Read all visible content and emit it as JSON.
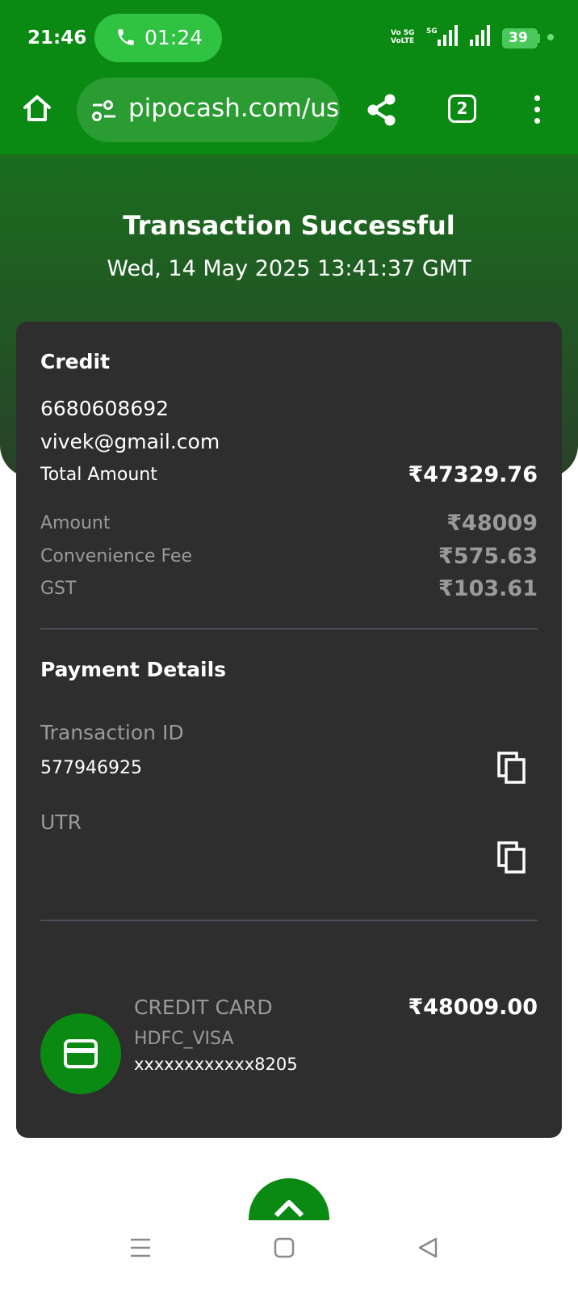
{
  "status_bar": {
    "time": "21:46",
    "call_timer": "01:24",
    "network_label_1": "Vo 5G",
    "network_label_2": "VoLTE",
    "network_type": "5G",
    "battery": "39"
  },
  "browser": {
    "url": "pipocash.com/us",
    "tab_count": "2"
  },
  "header": {
    "title": "Transaction Successful",
    "datetime": "Wed, 14 May 2025 13:41:37 GMT"
  },
  "summary": {
    "type_label": "Credit",
    "phone": "6680608692",
    "email": "vivek@gmail.com",
    "total_label": "Total Amount",
    "total_value": "₹47329.76",
    "rows": [
      {
        "label": "Amount",
        "value": "₹48009"
      },
      {
        "label": "Convenience Fee",
        "value": "₹575.63"
      },
      {
        "label": "GST",
        "value": "₹103.61"
      }
    ]
  },
  "payment_details": {
    "heading": "Payment Details",
    "transaction_id_label": "Transaction ID",
    "transaction_id": "577946925",
    "utr_label": "UTR",
    "utr_value": ""
  },
  "payment_method": {
    "type": "CREDIT CARD",
    "network": "HDFC_VISA",
    "card_number": "xxxxxxxxxxxx8205",
    "amount": "₹48009.00"
  },
  "colors": {
    "brand_green": "#0a8a12",
    "card_background": "#2e2e2e",
    "muted_text": "#9a9a9a"
  },
  "icons": {
    "home": "home-icon",
    "site_settings": "tune-icon",
    "share": "share-icon",
    "menu": "more-vertical-icon",
    "copy": "copy-icon",
    "card": "credit-card-icon",
    "scroll_up": "chevron-up-icon"
  }
}
